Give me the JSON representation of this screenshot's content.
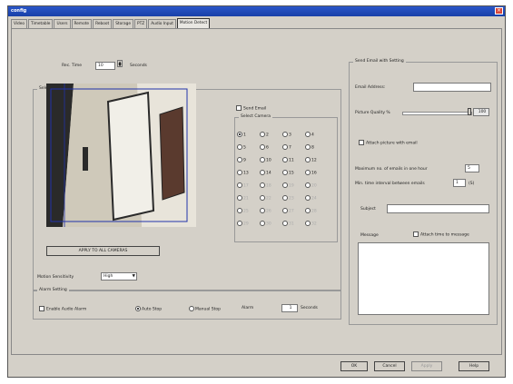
{
  "window": {
    "title": "config",
    "close_glyph": "×"
  },
  "tabs": [
    "Video",
    "Timetable",
    "Users",
    "Remote",
    "Reboot",
    "Storage",
    "PTZ",
    "Audio Input",
    "Motion Detect"
  ],
  "rec_time": {
    "label": "Rec. Time",
    "value": "10",
    "unit": "Seconds"
  },
  "select_camera": {
    "label": "Select Camera",
    "apply_button": "APPLY TO ALL CAMERAS"
  },
  "send_email": {
    "label": "Send Email"
  },
  "camera_select": {
    "label": "Select Camera",
    "cameras": [
      "1",
      "2",
      "3",
      "4",
      "5",
      "6",
      "7",
      "8",
      "9",
      "10",
      "11",
      "12",
      "13",
      "14",
      "15",
      "16",
      "17",
      "18",
      "19",
      "20",
      "21",
      "22",
      "23",
      "24",
      "25",
      "26",
      "27",
      "28",
      "29",
      "30",
      "31",
      "32"
    ],
    "selected": "1"
  },
  "motion_sensitivity": {
    "label": "Motion Sensitivity",
    "value": "High",
    "arrow": "▼"
  },
  "alarm_setting": {
    "label": "Alarm Setting",
    "enable_audio_alarm": "Enable Audio Alarm",
    "auto_stop": "Auto Stop",
    "manual_stop": "Manual Stop",
    "alarm_label": "Alarm",
    "alarm_value": "1",
    "alarm_unit": "Seconds"
  },
  "email_settings": {
    "label": "Send Email with Setting",
    "email_address_label": "Email Address:",
    "email_address_value": "",
    "picture_quality_label": "Picture Quality %",
    "picture_quality_value": "100",
    "picture_quality_level": 1.0,
    "attach_picture": "Attach picture with email",
    "max_attempts_label": "Maximum no. of emails in one hour",
    "max_attempts_value": "5",
    "min_interval_label": "Min. time interval between emails",
    "min_interval_value": "1",
    "min_interval_unit": "(S)",
    "subject_label": "Subject",
    "subject_value": "",
    "message_label": "Message",
    "attach_time": "Attach time to message",
    "message_value": ""
  },
  "footer": {
    "ok": "OK",
    "cancel": "Cancel",
    "apply": "Apply",
    "help": "Help"
  },
  "colors": {
    "titlebar": "#1840a8",
    "dialog_bg": "#d4d0c8",
    "close": "#d9473a"
  },
  "icons": {
    "spin_up": "▲",
    "spin_down": "▼"
  }
}
